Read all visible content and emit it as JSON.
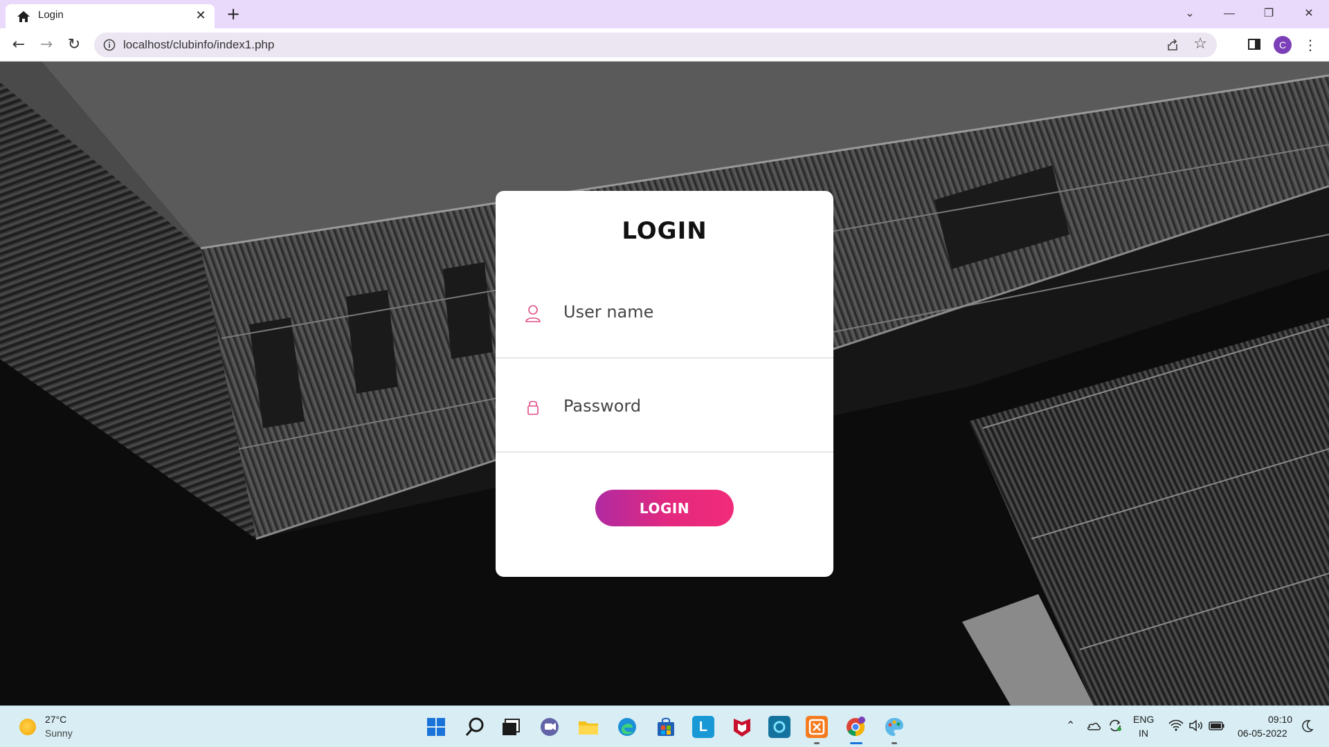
{
  "browser": {
    "tab_title": "Login",
    "url": "localhost/clubinfo/index1.php",
    "profile_initial": "C",
    "theme_color": "#e9d9fb"
  },
  "login": {
    "title": "LOGIN",
    "username_placeholder": "User name",
    "password_placeholder": "Password",
    "button_label": "LOGIN",
    "accent_start": "#b02aa1",
    "accent_end": "#f12b7a"
  },
  "taskbar": {
    "weather_temp": "27°C",
    "weather_desc": "Sunny",
    "apps": [
      "start-icon",
      "search-icon",
      "task-view-icon",
      "teams-chat-icon",
      "file-explorer-icon",
      "edge-icon",
      "store-icon",
      "l-app-icon",
      "mcafee-icon",
      "cortana-icon",
      "xampp-icon",
      "chrome-icon",
      "paint-icon"
    ],
    "lang_line1": "ENG",
    "lang_line2": "IN",
    "time": "09:10",
    "date": "06-05-2022"
  }
}
